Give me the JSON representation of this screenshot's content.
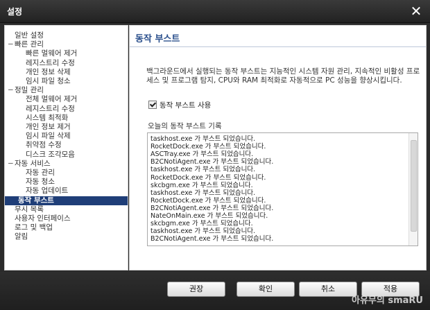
{
  "window": {
    "title": "설정",
    "close_glyph": "✕"
  },
  "sidebar": {
    "items": [
      {
        "label": "일반 설정",
        "toggle": "",
        "indent": 0
      },
      {
        "label": "빠른 관리",
        "toggle": "−",
        "indent": 0
      },
      {
        "label": "빠른 멀웨어 제거",
        "toggle": "",
        "indent": 1
      },
      {
        "label": "레지스트리 수정",
        "toggle": "",
        "indent": 1
      },
      {
        "label": "개인 정보 삭제",
        "toggle": "",
        "indent": 1
      },
      {
        "label": "임시 파일 청소",
        "toggle": "",
        "indent": 1
      },
      {
        "label": "정밀 관리",
        "toggle": "−",
        "indent": 0
      },
      {
        "label": "전체 멀웨어 제거",
        "toggle": "",
        "indent": 1
      },
      {
        "label": "레지스트리 수정",
        "toggle": "",
        "indent": 1
      },
      {
        "label": "시스템 최적화",
        "toggle": "",
        "indent": 1
      },
      {
        "label": "개인 정보 제거",
        "toggle": "",
        "indent": 1
      },
      {
        "label": "임시 파일 삭제",
        "toggle": "",
        "indent": 1
      },
      {
        "label": "취약점 수정",
        "toggle": "",
        "indent": 1
      },
      {
        "label": "디스크 조각모음",
        "toggle": "",
        "indent": 1
      },
      {
        "label": "자동 서비스",
        "toggle": "−",
        "indent": 0
      },
      {
        "label": "자동 관리",
        "toggle": "",
        "indent": 1
      },
      {
        "label": "자동 청소",
        "toggle": "",
        "indent": 1
      },
      {
        "label": "자동 업데이트",
        "toggle": "",
        "indent": 1
      },
      {
        "label": "동작 부스트",
        "toggle": "",
        "indent": 0,
        "selected": true
      },
      {
        "label": "무시 목록",
        "toggle": "",
        "indent": 0
      },
      {
        "label": "사용자 인터페이스",
        "toggle": "",
        "indent": 0
      },
      {
        "label": "로그 및 백업",
        "toggle": "",
        "indent": 0
      },
      {
        "label": "알림",
        "toggle": "",
        "indent": 0
      }
    ]
  },
  "main": {
    "title": "동작 부스트",
    "description": "백그라운드에서 실행되는 동작 부스트는 지능적인 시스템 자원 관리, 지속적인 비활성 프로세스 및 프로그램 탐지, CPU와 RAM 최적화로 자동적으로 PC 성능을 향상시킵니다.",
    "checkbox_label": "동작 부스트 사용",
    "checkbox_checked": true,
    "log_label": "오늘의 동작 부스트 기록",
    "log_entries": [
      "taskhost.exe 가 부스트 되었습니다.",
      "RocketDock.exe 가 부스트 되었습니다.",
      "ASCTray.exe 가 부스트 되었습니다.",
      "B2CNotiAgent.exe 가 부스트 되었습니다.",
      "taskhost.exe 가 부스트 되었습니다.",
      "RocketDock.exe 가 부스트 되었습니다.",
      "skcbgm.exe 가 부스트 되었습니다.",
      "taskhost.exe 가 부스트 되었습니다.",
      "RocketDock.exe 가 부스트 되었습니다.",
      "B2CNotiAgent.exe 가 부스트 되었습니다.",
      "NateOnMain.exe 가 부스트 되었습니다.",
      "skcbgm.exe 가 부스트 되었습니다.",
      "taskhost.exe 가 부스트 되었습니다.",
      "B2CNotiAgent.exe 가 부스트 되었습니다."
    ]
  },
  "footer": {
    "buttons": [
      "권장",
      "확인",
      "취소",
      "적용"
    ],
    "watermark": "아유무의 smaRU"
  },
  "colors": {
    "accent": "#2a4f8c",
    "selected_bg": "#1f3e78",
    "chrome": "#2b2b2b"
  }
}
